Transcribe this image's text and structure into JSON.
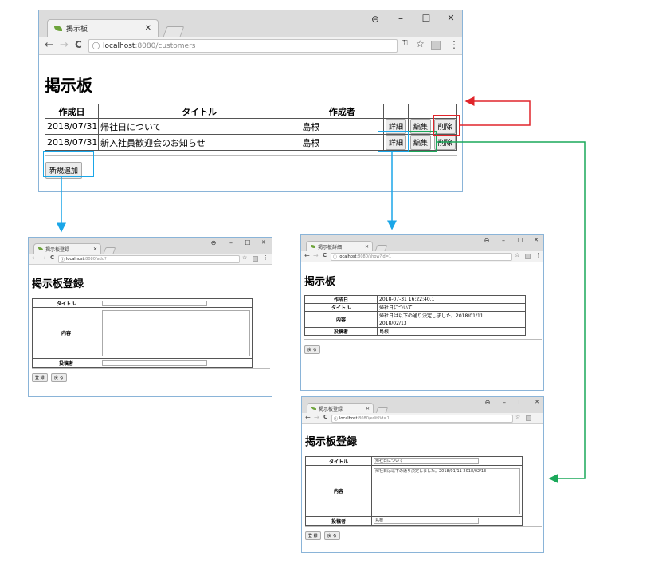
{
  "colors": {
    "red": "#e0252b",
    "blue": "#1aa6e8",
    "green": "#1aa85a",
    "frame": "#8ab4d8"
  },
  "icons": [
    "account-circle-icon",
    "minimize-icon",
    "maximize-icon",
    "close-icon",
    "back-arrow-icon",
    "forward-arrow-icon",
    "reload-icon",
    "info-icon",
    "key-icon",
    "star-icon",
    "extension-icon",
    "more-vert-icon",
    "leaf-favicon"
  ],
  "winctl": {
    "account": "⊖",
    "min": "–",
    "max": "☐",
    "close": "✕"
  },
  "nav": {
    "back": "←",
    "fwd": "→",
    "reload": "C",
    "info": "ⓘ",
    "key": "⚿",
    "star": "☆",
    "menu": "⋮"
  },
  "main": {
    "tab_title": "掲示板",
    "tab_close": "✕",
    "url_host": "localhost",
    "url_path": ":8080/customers",
    "heading": "掲示板",
    "columns": [
      "作成日",
      "タイトル",
      "作成者"
    ],
    "rows": [
      {
        "date": "2018/07/31",
        "title": "帰社日について",
        "author": "島根"
      },
      {
        "date": "2018/07/31",
        "title": "新入社員歓迎会のお知らせ",
        "author": "島根"
      }
    ],
    "detail_btn": "詳細",
    "edit_btn": "編集",
    "delete_btn": "削除",
    "add_btn": "新規追加"
  },
  "add": {
    "tab_title": "掲示板登録",
    "tab_close": "✕",
    "url_host": "localhost",
    "url_path": ":8080/add?",
    "heading": "掲示板登録",
    "labels": {
      "title": "タイトル",
      "body": "内容",
      "author": "投稿者"
    },
    "register_btn": "登 録",
    "back_btn": "戻 る"
  },
  "detail": {
    "tab_title": "掲示板詳細",
    "tab_close": "✕",
    "url_host": "localhost",
    "url_path": ":8080/show?id=1",
    "heading": "掲示板",
    "labels": {
      "created": "作成日",
      "title": "タイトル",
      "body": "内容",
      "author": "投稿者"
    },
    "values": {
      "created": "2018-07-31 16:22:40.1",
      "title": "帰社日について",
      "body_line1": "帰社日は以下の通り決定しました。2018/01/11",
      "body_line2": "2018/02/13",
      "author": "島根"
    },
    "back_btn": "戻 る"
  },
  "edit": {
    "tab_title": "掲示板登録",
    "tab_close": "✕",
    "url_host": "localhost",
    "url_path": ":8080/edit?id=1",
    "heading": "掲示板登録",
    "labels": {
      "title": "タイトル",
      "body": "内容",
      "author": "投稿者"
    },
    "values": {
      "title": "帰社日について",
      "body": "帰社日は以下の通り決定しました。2018/01/11  2018/02/13",
      "author": "島根"
    },
    "register_btn": "登 録",
    "back_btn": "戻 る"
  }
}
